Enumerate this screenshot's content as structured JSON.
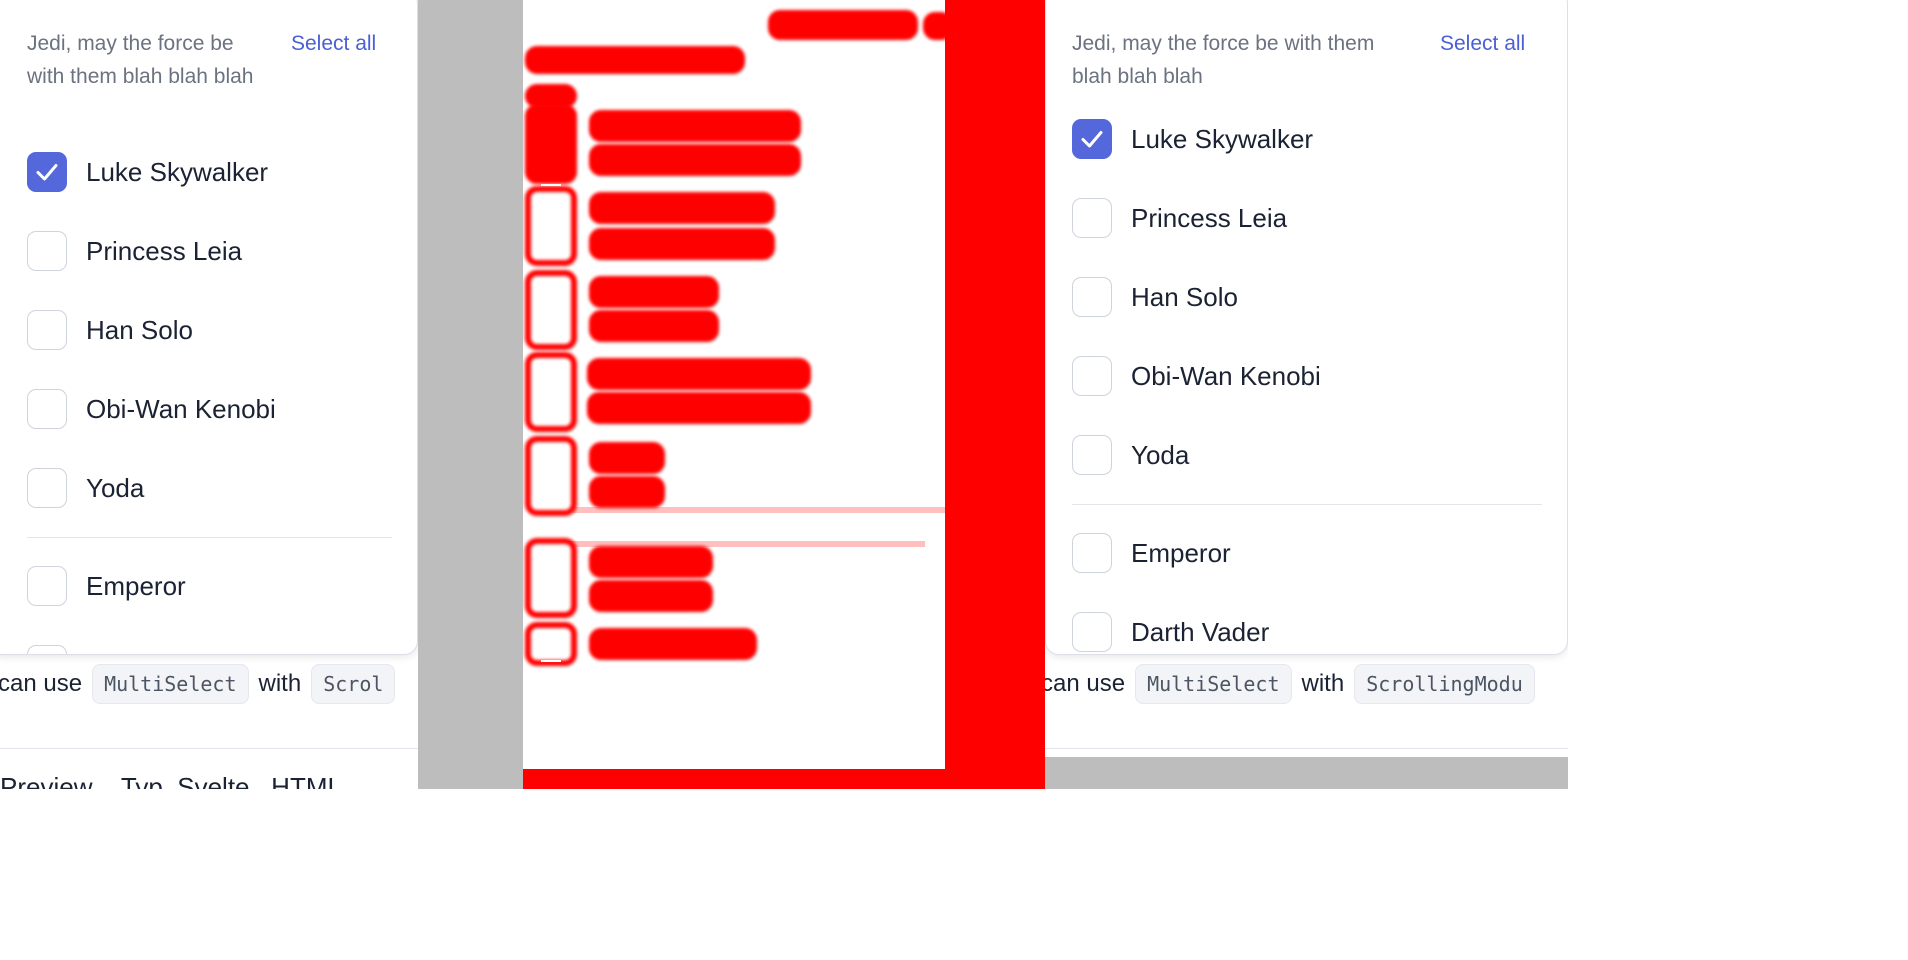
{
  "left": {
    "helper_text": "Jedi, may the force be with them blah blah blah",
    "select_all": "Select all",
    "options": [
      {
        "label": "Luke Skywalker",
        "checked": true
      },
      {
        "label": "Princess Leia",
        "checked": false
      },
      {
        "label": "Han Solo",
        "checked": false
      },
      {
        "label": "Obi-Wan Kenobi",
        "checked": false
      },
      {
        "label": "Yoda",
        "checked": false
      },
      {
        "label": "Emperor",
        "checked": false
      }
    ],
    "caption_prefix": "can use",
    "caption_code1": "MultiSelect",
    "caption_mid": "with",
    "caption_code2": "Scrol",
    "bottom_text": "Preview    Typ  Svelte   HTML"
  },
  "right": {
    "helper_text": "Jedi, may the force be with them blah blah blah",
    "select_all": "Select all",
    "options": [
      {
        "label": "Luke Skywalker",
        "checked": true
      },
      {
        "label": "Princess Leia",
        "checked": false
      },
      {
        "label": "Han Solo",
        "checked": false
      },
      {
        "label": "Obi-Wan Kenobi",
        "checked": false
      },
      {
        "label": "Yoda",
        "checked": false
      },
      {
        "label": "Emperor",
        "checked": false
      },
      {
        "label": "Darth Vader",
        "checked": false
      }
    ],
    "caption_prefix": "can use",
    "caption_code1": "MultiSelect",
    "caption_mid": "with",
    "caption_code2": "ScrollingModu"
  },
  "colors": {
    "accent": "#5468db",
    "link": "#4a5fd6",
    "diff_red": "#ff0000",
    "gutter_gray": "#bdbdbd"
  }
}
